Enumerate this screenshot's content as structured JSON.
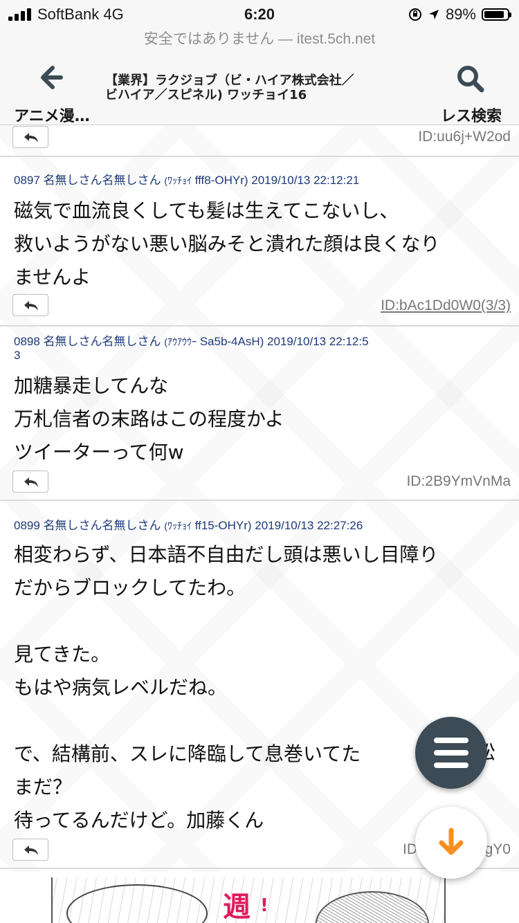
{
  "status_bar": {
    "carrier": "SoftBank 4G",
    "time": "6:20",
    "battery": "89%",
    "battery_level": 0.89
  },
  "url_bar": {
    "text": "安全ではありません — itest.5ch.net"
  },
  "header": {
    "back_label": "アニメ漫…",
    "title_line1": "【業界】ラクジョブ（ビ・ハイア株式会社／",
    "title_line2": "ビハイア／スピネル) ワッチョイ16",
    "search_label": "レス検索"
  },
  "posts": [
    {
      "id": "ID:uu6j+W2od"
    },
    {
      "number": "0897",
      "name": "名無しさん名無しさん",
      "kana": "(ﾜｯﾁｮｲ",
      "trip": " fff8-OHYr)",
      "datetime": "2019/10/13 22:12:21",
      "body": "磁気で血流良くしても髪は生えてこないし、\n救いようがない悪い脳みそと潰れた顔は良くなり\nませんよ",
      "id": "ID:bAc1Dd0W0(3/3)"
    },
    {
      "number": "0898",
      "name": "名無しさん名無しさん",
      "kana": "(ｱｳｱｳｳｰ",
      "trip": " Sa5b-4AsH)",
      "datetime": "2019/10/13 22:12:5",
      "datetime_wrap": "3",
      "body": "加糖暴走してんな\n万札信者の末路はこの程度かよ\nツイーターって何w",
      "id": "ID:2B9YmVnMa"
    },
    {
      "number": "0899",
      "name": "名無しさん名無しさん",
      "kana": "(ﾜｯﾁｮｲ",
      "trip": " ff15-OHYr)",
      "datetime": "2019/10/13 22:27:26",
      "body": "相変わらず、日本語不自由だし頭は悪いし目障り\nだからブロックしてたわ。\n\n見てきた。\nもはや病気レベルだね。\n\nで、結構前、スレに降臨して息巻いてた",
      "body_after_fab": "松",
      "body_tail": "まだ？\n待ってるんだけど。加藤くん",
      "id_left": "ID",
      "id_right": "gY0"
    }
  ],
  "ad": {
    "text": "週",
    "text2": "!"
  },
  "fab": {
    "menu_icon": "hamburger-menu-icon",
    "down_icon": "arrow-down-icon",
    "down_color": "#f7901e",
    "menu_color": "#3c4b55"
  }
}
